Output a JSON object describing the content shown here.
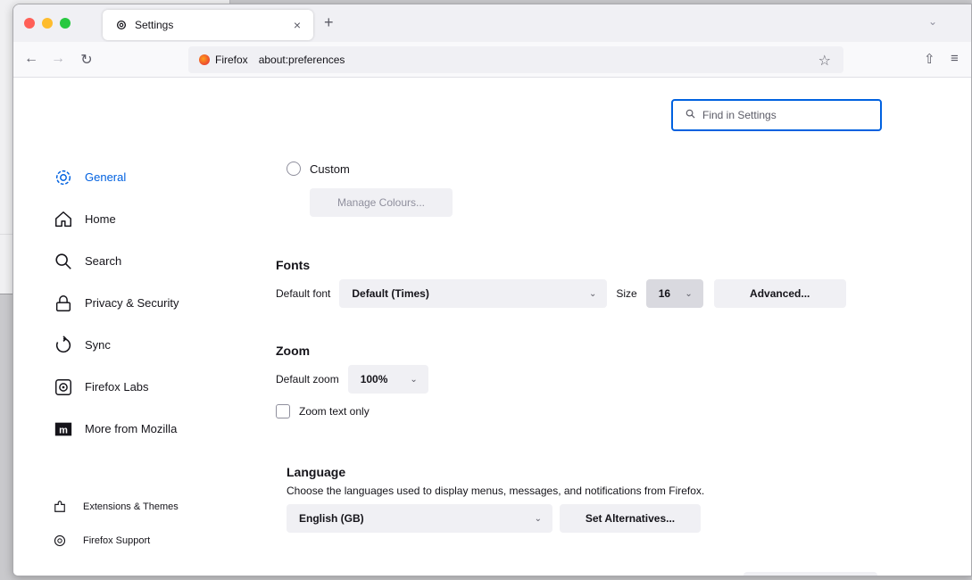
{
  "tab": {
    "title": "Settings",
    "close": "×",
    "new_tab": "+"
  },
  "nav": {
    "identity": "Firefox",
    "url": "about:preferences"
  },
  "search": {
    "placeholder": "Find in Settings"
  },
  "sidebar": {
    "items": [
      {
        "label": "General",
        "icon": "gear-icon",
        "active": true
      },
      {
        "label": "Home",
        "icon": "home-icon"
      },
      {
        "label": "Search",
        "icon": "search-icon"
      },
      {
        "label": "Privacy & Security",
        "icon": "lock-icon"
      },
      {
        "label": "Sync",
        "icon": "sync-icon"
      },
      {
        "label": "Firefox Labs",
        "icon": "labs-icon"
      },
      {
        "label": "More from Mozilla",
        "icon": "mozilla-icon"
      }
    ],
    "footer": [
      {
        "label": "Extensions & Themes",
        "icon": "puzzle-icon"
      },
      {
        "label": "Firefox Support",
        "icon": "help-icon"
      }
    ]
  },
  "colours": {
    "custom_label": "Custom",
    "manage_button": "Manage Colours..."
  },
  "fonts": {
    "heading": "Fonts",
    "default_font_label": "Default font",
    "default_font_value": "Default (Times)",
    "size_label": "Size",
    "size_value": "16",
    "advanced_button": "Advanced..."
  },
  "zoom": {
    "heading": "Zoom",
    "default_zoom_label": "Default zoom",
    "default_zoom_value": "100%",
    "zoom_text_only_label": "Zoom text only"
  },
  "language": {
    "heading": "Language",
    "description": "Choose the languages used to display menus, messages, and notifications from Firefox.",
    "selected": "English (GB)",
    "set_alternatives_button": "Set Alternatives..."
  },
  "colors": {
    "accent": "#0061e0"
  }
}
